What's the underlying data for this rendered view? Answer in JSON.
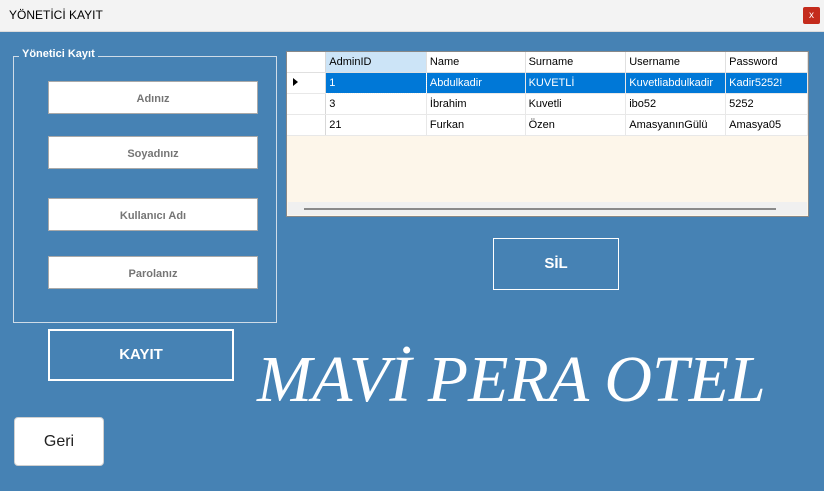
{
  "window": {
    "title": "YÖNETİCİ KAYIT",
    "close_label": "x"
  },
  "form": {
    "group_title": "Yönetici Kayıt",
    "name_placeholder": "Adınız",
    "surname_placeholder": "Soyadınız",
    "username_placeholder": "Kullanıcı Adı",
    "password_placeholder": "Parolanız",
    "save_label": "KAYIT"
  },
  "delete_label": "SİL",
  "back_label": "Geri",
  "brand": "MAVİ PERA OTEL",
  "grid": {
    "columns": [
      "AdminID",
      "Name",
      "Surname",
      "Username",
      "Password"
    ],
    "rows": [
      [
        "1",
        "Abdulkadir",
        "KUVETLİ",
        "Kuvetliabdulkadir",
        "Kadir5252!"
      ],
      [
        "3",
        "İbrahim",
        "Kuvetli",
        "ibo52",
        "5252"
      ],
      [
        "21",
        "Furkan",
        "Özen",
        "AmasyanınGülü",
        "Amasya05"
      ]
    ],
    "selected_row": 0
  },
  "colors": {
    "background": "#4682b4",
    "selection": "#0078d7",
    "grid_empty": "#fdf6ea"
  }
}
